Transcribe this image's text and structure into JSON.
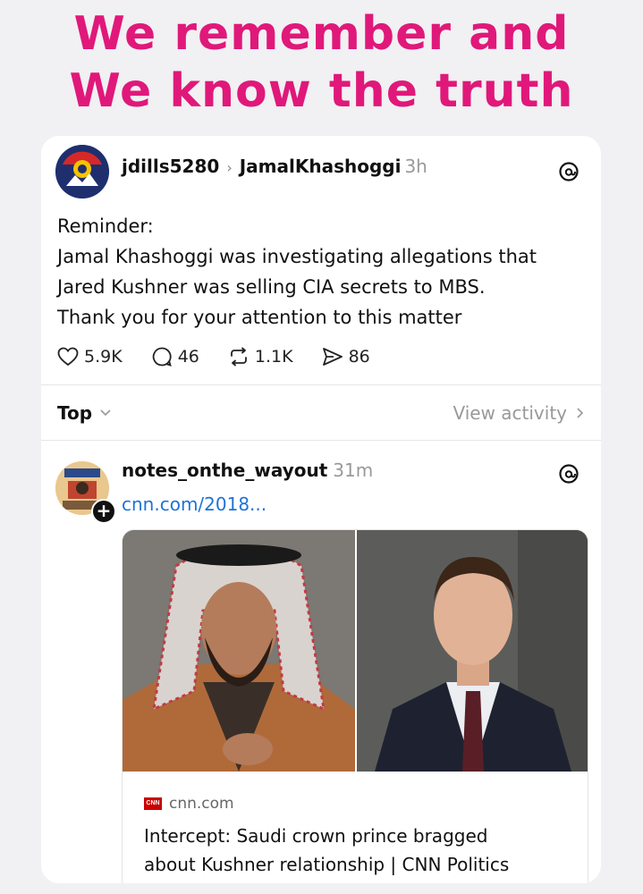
{
  "headline": {
    "line1": "We remember and",
    "line2": "We know the truth"
  },
  "post1": {
    "username": "jdills5280",
    "reply_to": "JamalKhashoggi",
    "time": "3h",
    "text_lines": [
      "Reminder:",
      "Jamal Khashoggi was investigating allegations that",
      "Jared Kushner was selling CIA secrets to MBS.",
      "Thank you for your attention to this matter"
    ],
    "likes": "5.9K",
    "replies": "46",
    "reposts": "1.1K",
    "shares": "86"
  },
  "sort": {
    "label": "Top",
    "view_activity": "View activity"
  },
  "post2": {
    "username": "notes_onthe_wayout",
    "time": "31m",
    "link_short": "cnn.com/2018...",
    "link_card": {
      "source": "cnn.com",
      "title_line1": "Intercept: Saudi crown prince bragged",
      "title_line2": "about Kushner relationship | CNN Politics"
    }
  },
  "colors": {
    "headline": "#e0187a",
    "link": "#1e73d6",
    "muted": "#999999",
    "cnn_red": "#cc0000"
  },
  "icons": [
    "heart-icon",
    "comment-icon",
    "repost-icon",
    "share-icon",
    "threads-icon",
    "chevron-down-icon",
    "chevron-right-icon",
    "plus-icon"
  ]
}
